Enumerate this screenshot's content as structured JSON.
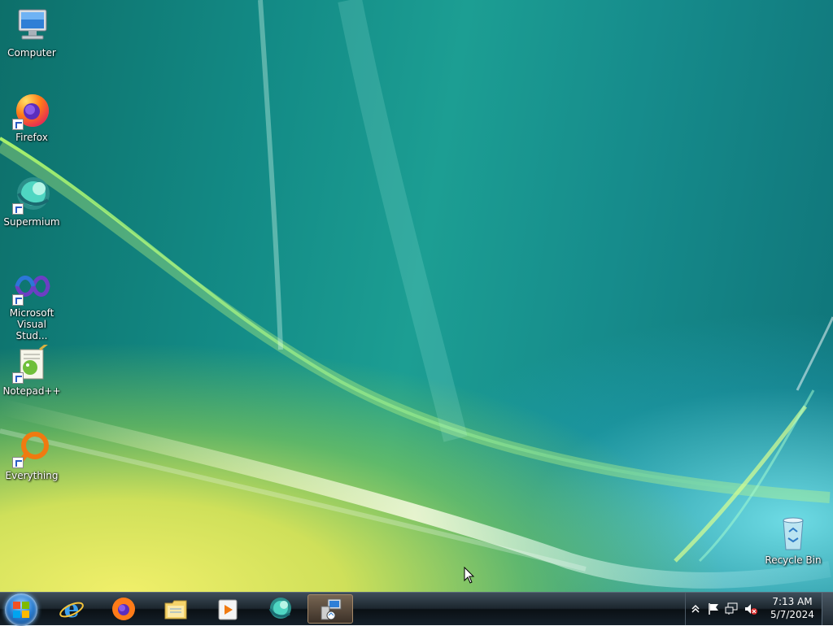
{
  "desktop": {
    "icons": [
      {
        "label": "Computer"
      },
      {
        "label": "Firefox"
      },
      {
        "label": "Supermium"
      },
      {
        "label": "Microsoft Visual Stud..."
      },
      {
        "label": "Notepad++"
      },
      {
        "label": "Everything"
      },
      {
        "label": "Recycle Bin"
      }
    ]
  },
  "taskbar": {
    "start_icon": "windows-logo-icon",
    "pinned": [
      {
        "icon": "internet-explorer-icon"
      },
      {
        "icon": "firefox-icon"
      },
      {
        "icon": "file-explorer-icon"
      },
      {
        "icon": "media-player-icon"
      },
      {
        "icon": "supermium-icon"
      },
      {
        "icon": "remote-desktop-icon",
        "active": true
      }
    ],
    "tray": {
      "icons": [
        "show-hidden-icons-icon",
        "action-center-flag-icon",
        "network-icon",
        "volume-muted-icon"
      ],
      "time": "7:13 AM",
      "date": "5/7/2024"
    }
  },
  "colors": {
    "desktop_teal": "#138b86",
    "desktop_yellow": "#f0ef6a",
    "taskbar": "#1c262e"
  }
}
